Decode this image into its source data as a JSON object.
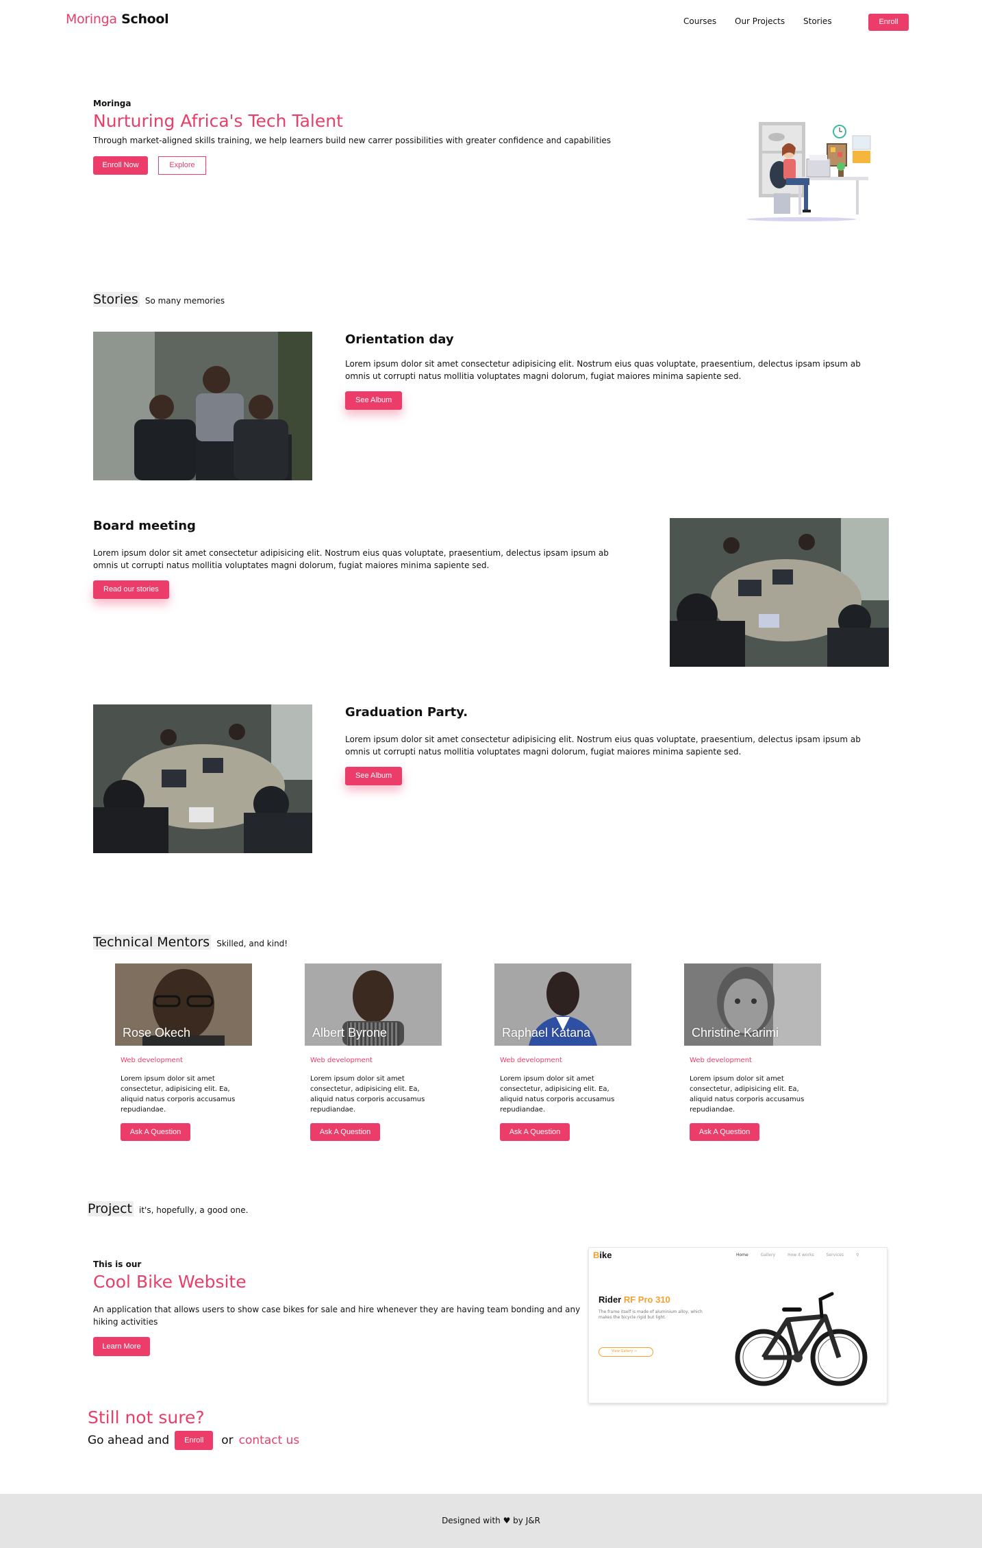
{
  "nav": {
    "brand_first": "Moringa",
    "brand_second": "School",
    "links": [
      "Courses",
      "Our Projects",
      "Stories"
    ],
    "enroll": "Enroll"
  },
  "hero": {
    "eyebrow": "Moringa",
    "title": "Nurturing Africa's Tech Talent",
    "text": "Through market-aligned skills training, we help learners build new carrer possibilities with greater confidence and capabilities",
    "enroll_now": "Enroll Now",
    "explore": "Explore"
  },
  "stories": {
    "title": "Stories",
    "subtitle": "So many memories",
    "items": [
      {
        "heading": "Orientation day",
        "text": "Lorem ipsum dolor sit amet consectetur adipisicing elit. Nostrum eius quas voluptate, praesentium, delectus ipsam ipsum ab omnis ut corrupti natus mollitia voluptates magni dolorum, fugiat maiores minima sapiente sed.",
        "button": "See Album"
      },
      {
        "heading": "Board meeting",
        "text": "Lorem ipsum dolor sit amet consectetur adipisicing elit. Nostrum eius quas voluptate, praesentium, delectus ipsam ipsum ab omnis ut corrupti natus mollitia voluptates magni dolorum, fugiat maiores minima sapiente sed.",
        "button": "Read our stories"
      },
      {
        "heading": "Graduation Party.",
        "text": "Lorem ipsum dolor sit amet consectetur adipisicing elit. Nostrum eius quas voluptate, praesentium, delectus ipsam ipsum ab omnis ut corrupti natus mollitia voluptates magni dolorum, fugiat maiores minima sapiente sed.",
        "button": "See Album"
      }
    ]
  },
  "mentors": {
    "title": "Technical Mentors",
    "subtitle": "Skilled, and kind!",
    "items": [
      {
        "name": "Rose Okech",
        "role": "Web development",
        "desc": "Lorem ipsum dolor sit amet consectetur, adipisicing elit. Ea, aliquid natus corporis accusamus repudiandae.",
        "button": "Ask A Question"
      },
      {
        "name": "Albert Byrone",
        "role": "Web development",
        "desc": "Lorem ipsum dolor sit amet consectetur, adipisicing elit. Ea, aliquid natus corporis accusamus repudiandae.",
        "button": "Ask A Question"
      },
      {
        "name": "Raphael Katana",
        "role": "Web development",
        "desc": "Lorem ipsum dolor sit amet consectetur, adipisicing elit. Ea, aliquid natus corporis accusamus repudiandae.",
        "button": "Ask A Question"
      },
      {
        "name": "Christine Karimi",
        "role": "Web development",
        "desc": "Lorem ipsum dolor sit amet consectetur, adipisicing elit. Ea, aliquid natus corporis accusamus repudiandae.",
        "button": "Ask A Question"
      }
    ]
  },
  "project": {
    "title": "Project",
    "subtitle": "it's, hopefully, a good one.",
    "eyebrow": "This is our",
    "name": "Cool Bike Website",
    "text": "An application that allows users to show case bikes for sale and hire whenever they are having team bonding and any hiking activities",
    "button": "Learn More",
    "screenshot": {
      "logo_b": "B",
      "logo_rest": "ike",
      "nav": [
        "Home",
        "Gallery",
        "How it works",
        "Services"
      ],
      "heading_a": "Rider",
      "heading_b": "RF Pro 310",
      "text": "The frame itself is made of aluminium alloy, which makes the bicycle rigid but light.",
      "button": "View Gallery"
    }
  },
  "cta": {
    "title": "Still not sure?",
    "pre": "Go ahead and",
    "enroll": "Enroll",
    "or": "or",
    "contact": "contact us"
  },
  "footer": {
    "text": "Designed with ♥ by J&R"
  },
  "colors": {
    "accent": "#ec3d6a",
    "footer_bg": "#e4e4e4",
    "bike_orange": "#f6a02d"
  }
}
